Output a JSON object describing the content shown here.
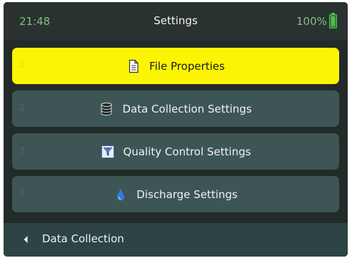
{
  "status_bar": {
    "time": "21:48",
    "title": "Settings",
    "battery": "100%",
    "battery_icon": "battery-full-icon"
  },
  "menu": {
    "items": [
      {
        "number": "1",
        "label": "File Properties",
        "icon": "document-icon",
        "selected": true
      },
      {
        "number": "2",
        "label": "Data Collection Settings",
        "icon": "database-icon",
        "selected": false
      },
      {
        "number": "3",
        "label": "Quality Control Settings",
        "icon": "quality-control-icon",
        "selected": false
      },
      {
        "number": "4",
        "label": "Discharge Settings",
        "icon": "water-drop-icon",
        "selected": false
      }
    ]
  },
  "bottom_bar": {
    "back_label": "Data Collection",
    "back_icon": "chevron-left-icon"
  },
  "colors": {
    "background": "#232a2a",
    "item_background": "#3e5555",
    "selected_background": "#fcf405",
    "status_green": "#7ec07e",
    "battery_green": "#49c24d"
  }
}
